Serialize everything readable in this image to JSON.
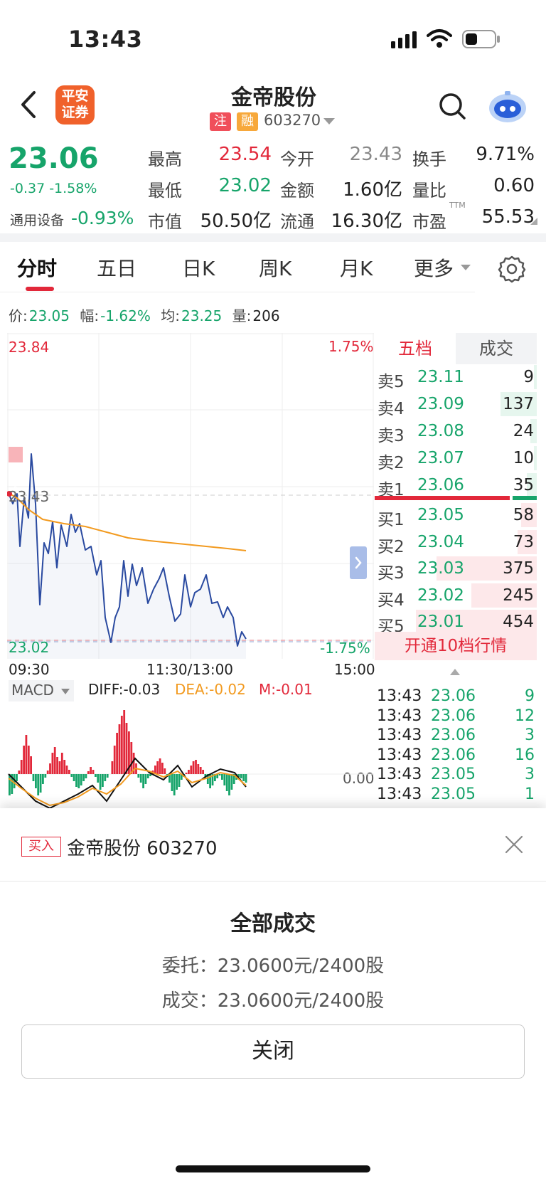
{
  "status_bar": {
    "time": "13:43"
  },
  "header": {
    "broker_logo": "平安\n证券",
    "broker_logo_line1": "平安",
    "broker_logo_line2": "证券",
    "title": "金帝股份",
    "tag_registered": "注",
    "tag_margin": "融",
    "code": "603270"
  },
  "quote": {
    "price": "23.06",
    "change": "-0.37 -1.58%",
    "sector_name": "通用设备",
    "sector_change": "-0.93%",
    "stats": [
      {
        "label": "最高",
        "value": "23.54"
      },
      {
        "label": "今开",
        "value": "23.43"
      },
      {
        "label": "换手",
        "value": "9.71%"
      },
      {
        "label": "最低",
        "value": "23.02"
      },
      {
        "label": "金额",
        "value": "1.60亿"
      },
      {
        "label": "量比",
        "value": "0.60"
      },
      {
        "label": "市值",
        "value": "50.50亿"
      },
      {
        "label": "流通",
        "value": "16.30亿"
      },
      {
        "label": "市盈",
        "value": "55.53"
      }
    ],
    "pe_suffix": "TTM"
  },
  "tabs": [
    "分时",
    "五日",
    "日K",
    "周K",
    "月K",
    "更多"
  ],
  "info_line": {
    "price_label": "价:",
    "price": "23.05",
    "range_label": "幅:",
    "range": "-1.62%",
    "avg_label": "均:",
    "avg": "23.25",
    "vol_label": "量:",
    "vol": "206"
  },
  "chart": {
    "y_high": "23.84",
    "pct_high": "1.75%",
    "y_ref": "23.43",
    "y_low": "23.02",
    "pct_low": "-1.75%",
    "x_start": "09:30",
    "x_mid": "11:30/13:00",
    "x_end": "15:00",
    "buy_marker": "买",
    "colors": {
      "price_line": "#2a4aa0",
      "avg_line": "#f29a1f",
      "up": "#e2283a",
      "down": "#16a46a"
    }
  },
  "macd": {
    "name": "MACD",
    "diff": "DIFF:-0.03",
    "dea": "DEA:-0.02",
    "m": "M:-0.01",
    "zero": "0.00"
  },
  "order_book": {
    "tab_five": "五档",
    "tab_trades": "成交",
    "asks": [
      {
        "label": "卖5",
        "price": "23.11",
        "volume": "9",
        "depth": 0.02
      },
      {
        "label": "卖4",
        "price": "23.09",
        "volume": "137",
        "depth": 0.3
      },
      {
        "label": "卖3",
        "price": "23.08",
        "volume": "24",
        "depth": 0.05
      },
      {
        "label": "卖2",
        "price": "23.07",
        "volume": "10",
        "depth": 0.02
      },
      {
        "label": "卖1",
        "price": "23.06",
        "volume": "35",
        "depth": 0.08
      }
    ],
    "bids": [
      {
        "label": "买1",
        "price": "23.05",
        "volume": "58",
        "depth": 0.13
      },
      {
        "label": "买2",
        "price": "23.04",
        "volume": "73",
        "depth": 0.16
      },
      {
        "label": "买3",
        "price": "23.03",
        "volume": "375",
        "depth": 0.83
      },
      {
        "label": "买4",
        "price": "23.02",
        "volume": "245",
        "depth": 0.54
      },
      {
        "label": "买5",
        "price": "23.01",
        "volume": "454",
        "depth": 1.0
      }
    ],
    "upgrade": "开通10档行情"
  },
  "trades": [
    {
      "time": "13:43",
      "price": "23.06",
      "volume": "9"
    },
    {
      "time": "13:43",
      "price": "23.06",
      "volume": "12"
    },
    {
      "time": "13:43",
      "price": "23.06",
      "volume": "3"
    },
    {
      "time": "13:43",
      "price": "23.06",
      "volume": "16"
    },
    {
      "time": "13:43",
      "price": "23.05",
      "volume": "3"
    },
    {
      "time": "13:43",
      "price": "23.05",
      "volume": "1"
    }
  ],
  "sheet": {
    "tag": "买入",
    "title": "金帝股份 603270",
    "status": "全部成交",
    "order_line": "委托：23.0600元/2400股",
    "fill_line": "成交：23.0600元/2400股",
    "close": "关闭"
  },
  "icons": [
    "back-arrow-icon",
    "search-icon",
    "robot-assistant-icon",
    "settings-gear-icon",
    "close-icon",
    "signal-icon",
    "wifi-icon",
    "battery-icon"
  ]
}
